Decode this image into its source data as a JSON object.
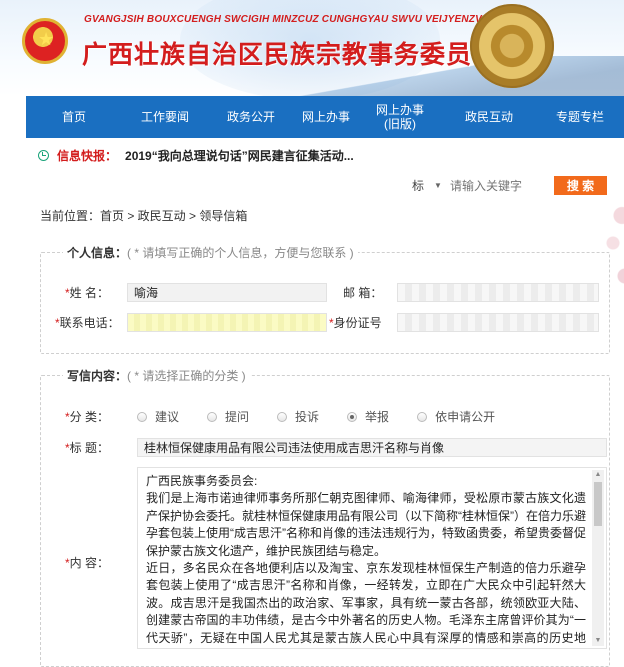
{
  "header": {
    "latin_title": "GVANGJSIH BOUXCUENGH SWCIGIH MINZCUZ CUNGHGYAU SWVU VEIJYENZVEI",
    "title": "广西壮族自治区民族宗教事务委员会"
  },
  "nav": {
    "items": [
      {
        "label": "首页"
      },
      {
        "label": "工作要闻"
      },
      {
        "label": "政务公开"
      },
      {
        "label": "网上办事"
      },
      {
        "label": "网上办事(旧版)"
      },
      {
        "label": "政民互动"
      },
      {
        "label": "专题专栏"
      }
    ]
  },
  "ticker": {
    "label": "信息快报：",
    "text": "2019“我向总理说句话”网民建言征集活动..."
  },
  "search": {
    "scope": "标",
    "placeholder": "请输入关键字",
    "button": "搜 索"
  },
  "breadcrumb": "当前位置：首页 > 政民互动 > 领导信箱",
  "personal": {
    "legend": "个人信息：",
    "hint": "( * 请填写正确的个人信息，方便与您联系 )",
    "name_label": "姓    名：",
    "name_value": "喻海",
    "email_label": "邮    箱：",
    "phone_label": "联系电话：",
    "id_label": "身份证号"
  },
  "letter": {
    "legend": "写信内容：",
    "hint": "( * 请选择正确的分类 )",
    "category_label": "分    类：",
    "categories": [
      "建议",
      "提问",
      "投诉",
      "举报",
      "依申请公开"
    ],
    "selected_category": "举报",
    "title_label": "标    题：",
    "title_value": "桂林恒保健康用品有限公司违法使用成吉思汗名称与肖像",
    "content_label": "内    容：",
    "content": [
      "广西民族事务委员会:",
      "我们是上海市诺迪律师事务所那仁朝克图律师、喻海律师，受松原市蒙古族文化遗产保护协会委托。就桂林恒保健康用品有限公司（以下简称“桂林恒保”）在倍力乐避孕套包装上使用“成吉思汗”名称和肖像的违法违规行为，特致函贵委，希望贵委督促保护蒙古族文化遗产，维护民族团结与稳定。",
      "近日，多名民众在各地便利店以及淘宝、京东发现桂林恒保生产制造的倍力乐避孕套包装上使用了“成吉思汗”名称和肖像，一经转发，立即在广大民众中引起轩然大波。成吉思汗是我国杰出的政治家、军事家，具有统一蒙古各部，统领欧亚大陆、创建蒙古帝国的丰功伟绩，是古今中外著名的历史人物。毛泽东主席曾评价其为“一代天骄”，无疑在中国人民尤其是蒙古族人民心中具有深厚的情感和崇高的历史地位。而桂林恒保在未获得授权的情况下违法使用成吉思汗名称和肖像的行为"
    ]
  }
}
